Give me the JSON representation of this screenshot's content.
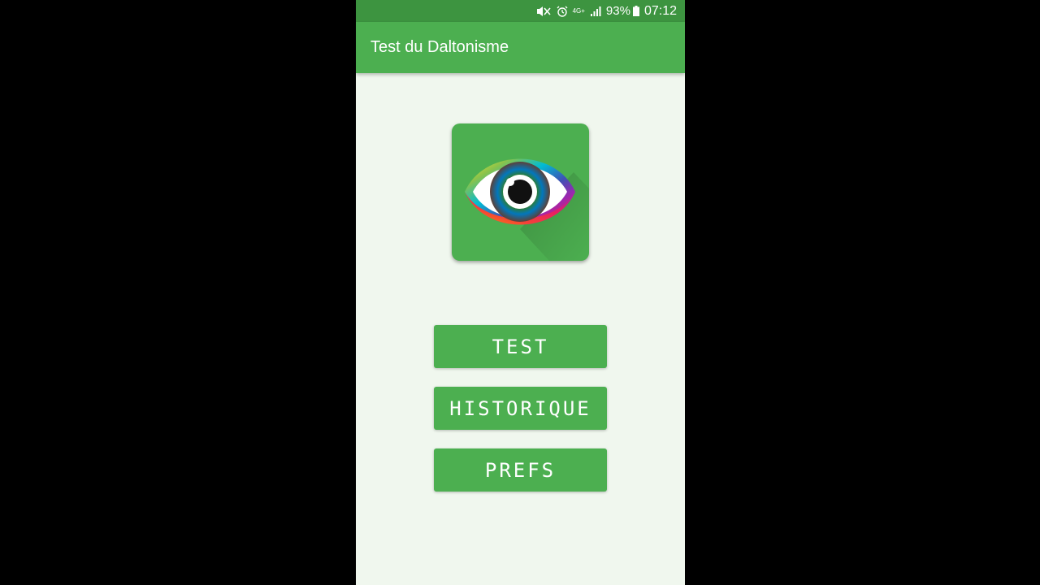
{
  "status_bar": {
    "battery": "93%",
    "time": "07:12",
    "network": "4G+",
    "icons": [
      "mute-icon",
      "alarm-icon",
      "network-icon",
      "signal-icon",
      "battery-icon"
    ]
  },
  "app_bar": {
    "title": "Test du Daltonisme"
  },
  "logo": {
    "icon": "rainbow-eye-icon",
    "bg_color": "#4caf50"
  },
  "buttons": {
    "test": "TEST",
    "history": "HISTORIQUE",
    "prefs": "PREFS"
  },
  "colors": {
    "primary": "#4caf50",
    "primary_dark": "#3d9440",
    "background": "#f0f7ee"
  }
}
